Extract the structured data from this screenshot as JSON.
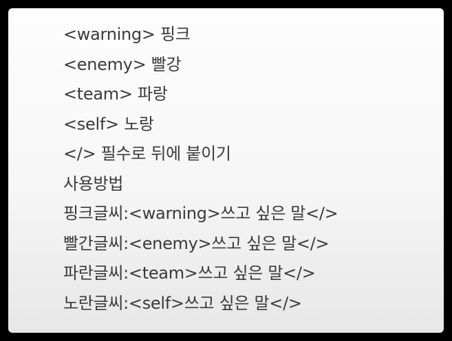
{
  "notes": {
    "lines": [
      "<warning> 핑크",
      "<enemy> 빨강",
      "<team> 파랑",
      "<self> 노랑",
      "</> 필수로 뒤에 붙이기",
      "사용방법",
      "핑크글씨:<warning>쓰고 싶은 말</>",
      "빨간글씨:<enemy>쓰고 싶은 말</>",
      "파란글씨:<team>쓰고 싶은 말</>",
      "노란글씨:<self>쓰고 싶은 말</>"
    ]
  },
  "colors": {
    "frame": "#000000",
    "panel_top": "#fdfdfd",
    "panel_bottom": "#e7e7e7",
    "text": "#3a3a3a"
  }
}
